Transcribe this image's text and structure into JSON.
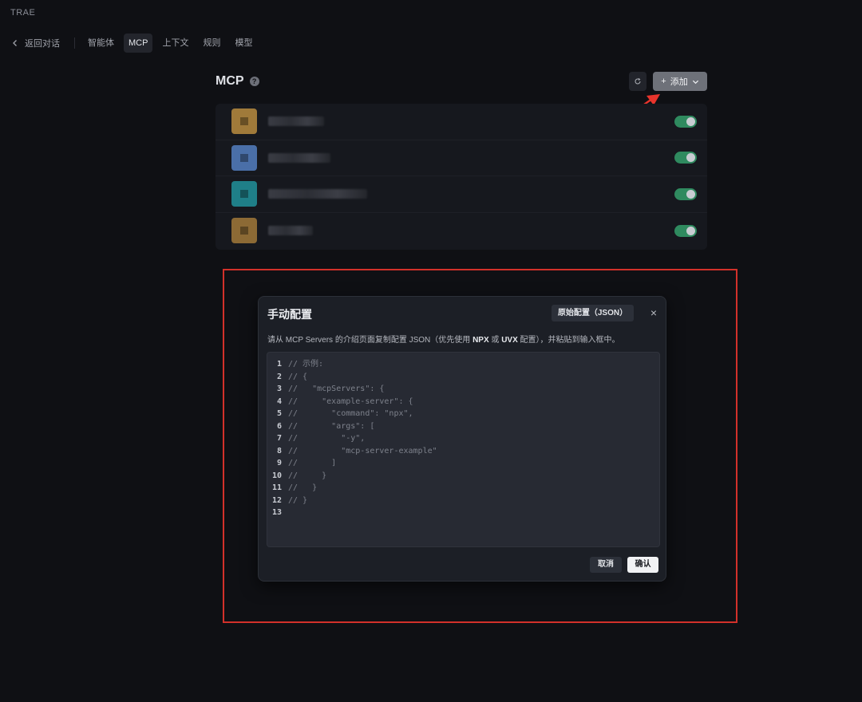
{
  "app": {
    "title": "TRAE"
  },
  "nav": {
    "back_label": "返回对话",
    "tabs": [
      {
        "label": "智能体",
        "active": false
      },
      {
        "label": "MCP",
        "active": true
      },
      {
        "label": "上下文",
        "active": false
      },
      {
        "label": "规则",
        "active": false
      },
      {
        "label": "模型",
        "active": false
      }
    ]
  },
  "mcp": {
    "title": "MCP",
    "help_icon": "?",
    "add_label": "添加",
    "servers": [
      {
        "icon_color": "#a07a3a",
        "enabled": true
      },
      {
        "icon_color": "#4a6fa8",
        "enabled": true
      },
      {
        "icon_color": "#1f7f88",
        "enabled": true
      },
      {
        "icon_color": "#8c6a35",
        "enabled": true
      }
    ]
  },
  "dialog": {
    "title": "手动配置",
    "raw_button": "原始配置（JSON）",
    "close_icon": "×",
    "description_parts": [
      "请从 MCP Servers 的介绍页面复制配置 JSON（优先使用 ",
      "NPX",
      " 或 ",
      "UVX",
      " 配置），并粘贴到输入框中。"
    ],
    "code_lines": [
      {
        "n": "1",
        "text": "// 示例:"
      },
      {
        "n": "2",
        "text": "// {"
      },
      {
        "n": "3",
        "text": "//   \"mcpServers\": {"
      },
      {
        "n": "4",
        "text": "//     \"example-server\": {"
      },
      {
        "n": "5",
        "text": "//       \"command\": \"npx\","
      },
      {
        "n": "6",
        "text": "//       \"args\": ["
      },
      {
        "n": "7",
        "text": "//         \"-y\","
      },
      {
        "n": "8",
        "text": "//         \"mcp-server-example\""
      },
      {
        "n": "9",
        "text": "//       ]"
      },
      {
        "n": "10",
        "text": "//     }"
      },
      {
        "n": "11",
        "text": "//   }"
      },
      {
        "n": "12",
        "text": "// }"
      },
      {
        "n": "13",
        "text": ""
      }
    ],
    "cancel_label": "取消",
    "confirm_label": "确认"
  },
  "colors": {
    "accent_toggle": "#2f8a5f",
    "highlight": "#d2312a",
    "arrow": "#e8342c"
  }
}
